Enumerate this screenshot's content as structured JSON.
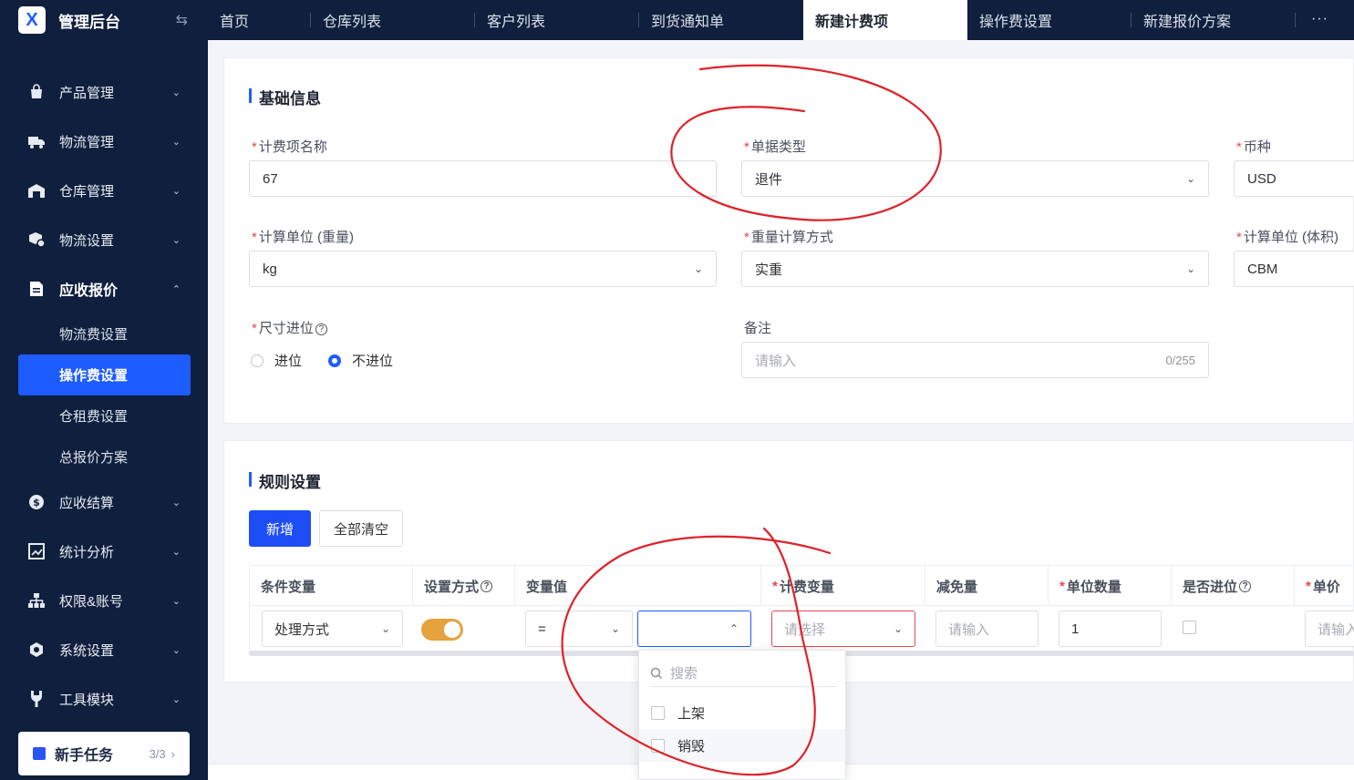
{
  "app": {
    "title": "管理后台",
    "logo_text": "X"
  },
  "tabs": [
    {
      "label": "首页"
    },
    {
      "label": "仓库列表"
    },
    {
      "label": "客户列表"
    },
    {
      "label": "到货通知单"
    },
    {
      "label": "新建计费项"
    },
    {
      "label": "操作费设置"
    },
    {
      "label": "新建报价方案"
    }
  ],
  "tab_more": "···",
  "sidebar": {
    "items": [
      {
        "label": "产品管理",
        "icon": "bag-icon"
      },
      {
        "label": "物流管理",
        "icon": "truck-icon"
      },
      {
        "label": "仓库管理",
        "icon": "warehouse-icon"
      },
      {
        "label": "物流设置",
        "icon": "box-gear-icon"
      },
      {
        "label": "应收报价",
        "icon": "document-icon"
      },
      {
        "label": "应收结算",
        "icon": "dollar-icon"
      },
      {
        "label": "统计分析",
        "icon": "chart-icon"
      },
      {
        "label": "权限&账号",
        "icon": "org-icon"
      },
      {
        "label": "系统设置",
        "icon": "hexagon-icon"
      },
      {
        "label": "工具模块",
        "icon": "tool-icon"
      }
    ],
    "submenu": [
      {
        "label": "物流费设置"
      },
      {
        "label": "操作费设置"
      },
      {
        "label": "仓租费设置"
      },
      {
        "label": "总报价方案"
      }
    ],
    "newbie": {
      "label": "新手任务",
      "count": "3/3"
    }
  },
  "basic": {
    "title": "基础信息",
    "fee_name": {
      "label": "计费项名称",
      "value": "67"
    },
    "doc_type": {
      "label": "单据类型",
      "value": "退件"
    },
    "currency": {
      "label": "币种",
      "value": "USD"
    },
    "weight_unit": {
      "label": "计算单位 (重量)",
      "value": "kg"
    },
    "weight_calc": {
      "label": "重量计算方式",
      "value": "实重"
    },
    "volume_unit": {
      "label": "计算单位 (体积)",
      "value": "CBM"
    },
    "size_round": {
      "label": "尺寸进位",
      "opt1": "进位",
      "opt2": "不进位",
      "selected": "不进位"
    },
    "remark": {
      "label": "备注",
      "placeholder": "请输入",
      "counter": "0/255"
    }
  },
  "rules": {
    "title": "规则设置",
    "add_btn": "新增",
    "clear_btn": "全部清空",
    "columns": [
      "条件变量",
      "设置方式",
      "变量值",
      "计费变量",
      "减免量",
      "单位数量",
      "是否进位",
      "单价"
    ],
    "row": {
      "cond_var": "处理方式",
      "operator": "=",
      "fee_var_placeholder": "请选择",
      "reduce_placeholder": "请输入",
      "unit_qty": "1",
      "price_placeholder": "请输入",
      "toggle_on": true
    }
  },
  "dropdown": {
    "search_placeholder": "搜索",
    "options": [
      {
        "label": "上架"
      },
      {
        "label": "销毁"
      }
    ]
  },
  "colors": {
    "brand": "#1d5cff",
    "sidebar_bg": "#0f1f3d",
    "toggle": "#e6a23c",
    "error": "#e5484d",
    "annotation": "#e0212a"
  }
}
